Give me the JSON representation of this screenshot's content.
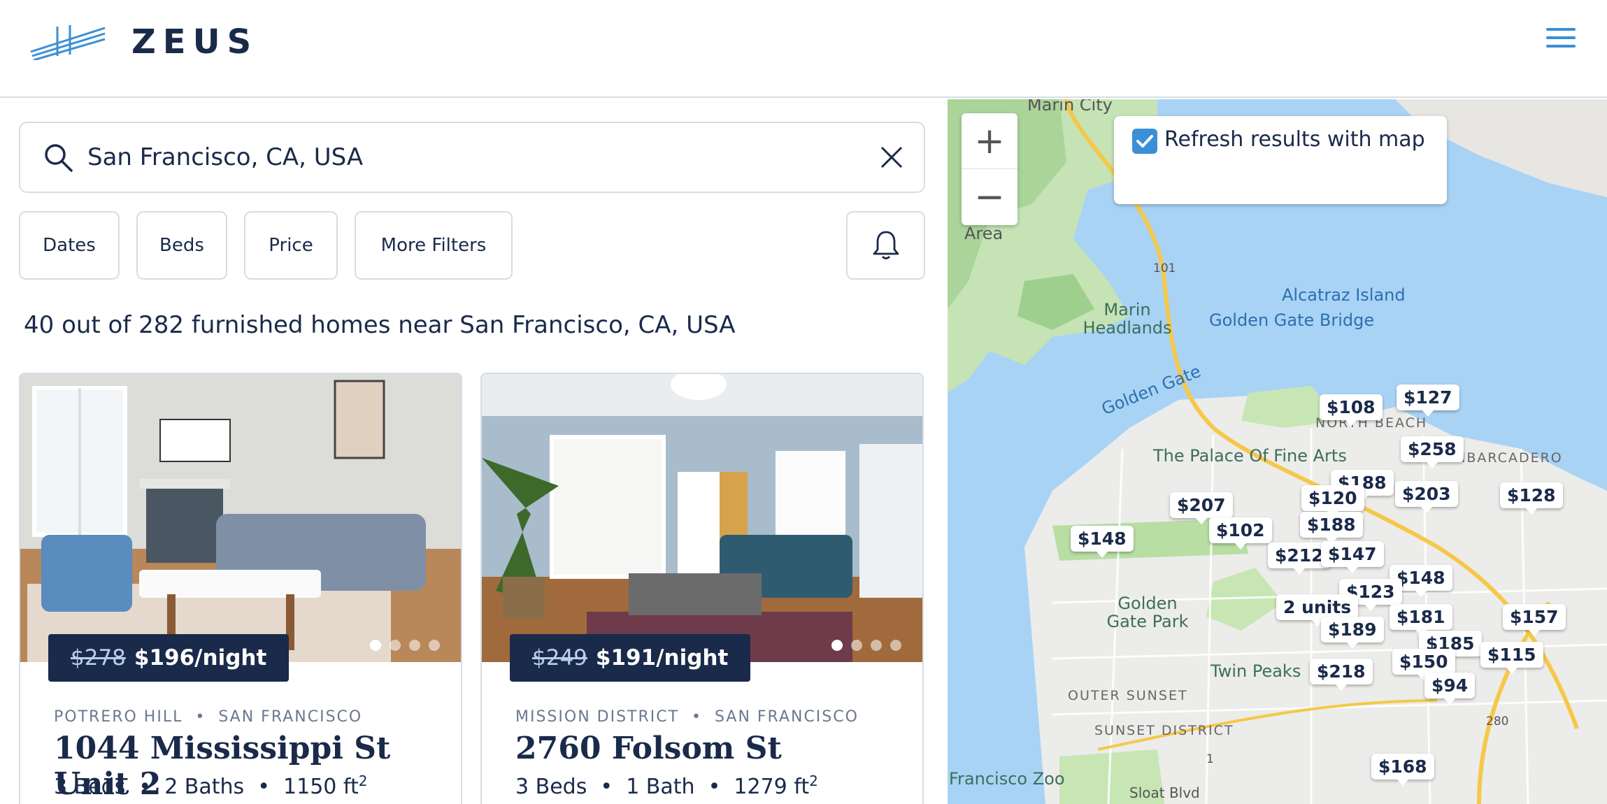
{
  "brand": {
    "name": "ZEUS"
  },
  "search": {
    "value": "San Francisco, CA, USA"
  },
  "filters": {
    "dates": "Dates",
    "beds": "Beds",
    "price": "Price",
    "more": "More Filters"
  },
  "results": {
    "text": "40 out of 282 furnished homes near San Francisco, CA, USA"
  },
  "listings": [
    {
      "old_price": "$278",
      "price": "$196/night",
      "neighborhood": "POTRERO HILL",
      "city": "SAN FRANCISCO",
      "address": "1044 Mississippi St Unit 2",
      "beds": "3 Beds",
      "baths": "2 Baths",
      "area": "1150 ft",
      "area_unit": "2"
    },
    {
      "old_price": "$249",
      "price": "$191/night",
      "neighborhood": "MISSION DISTRICT",
      "city": "SAN FRANCISCO",
      "address": "2760 Folsom St",
      "beds": "3 Beds",
      "baths": "1 Bath",
      "area": "1279 ft",
      "area_unit": "2"
    }
  ],
  "map": {
    "zoom_in": "+",
    "zoom_out": "−",
    "refresh_label": "Refresh results with map",
    "labels": {
      "marin_city": "Marin City",
      "alcatraz": "Alcatraz Island",
      "marin_headlands": "Marin Headlands",
      "golden_gate_bridge": "Golden Gate Bridge",
      "golden_gate": "Golden Gate",
      "north_beach": "NORTH BEACH",
      "embarcadero": "EMBARCADERO",
      "palace": "The Palace Of Fine Arts",
      "golden_gate_park": "Golden Gate Park",
      "twin_peaks": "Twin Peaks",
      "outer_sunset": "OUTER SUNSET",
      "sunset_district": "SUNSET DISTRICT",
      "sf_zoo": "Francisco Zoo",
      "sloat": "Sloat Blvd",
      "area": "Area",
      "hwy101": "101",
      "hwy1": "1",
      "hwy280": "280"
    },
    "pins": {
      "p108": "$108",
      "p127": "$127",
      "p258": "$258",
      "p188a": "$188",
      "p203": "$203",
      "p120": "$120",
      "p128": "$128",
      "p207": "$207",
      "p102": "$102",
      "p148a": "$148",
      "p188b": "$188",
      "p212": "$212",
      "p147": "$147",
      "p148b": "$148",
      "p123": "$123",
      "p2units": "2 units",
      "p189": "$189",
      "p181": "$181",
      "p157": "$157",
      "p185": "$185",
      "p115": "$115",
      "p150": "$150",
      "p218": "$218",
      "p94": "$94",
      "p168": "$168"
    }
  }
}
